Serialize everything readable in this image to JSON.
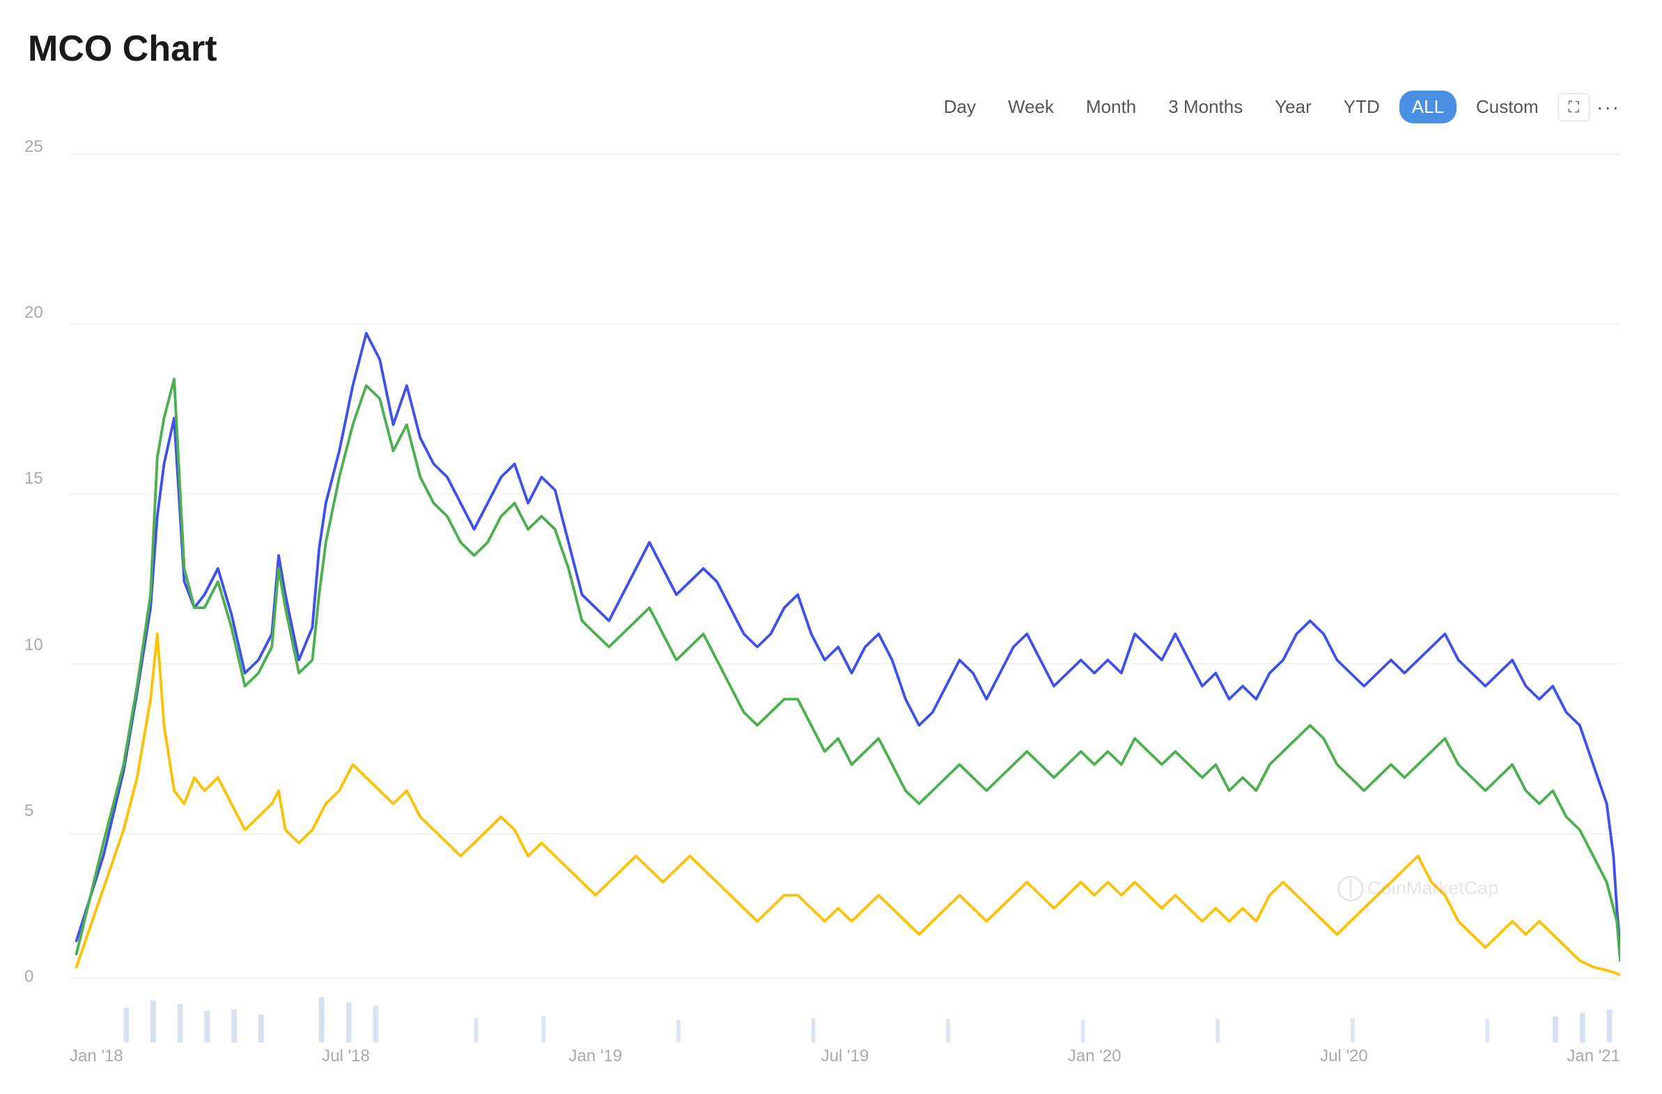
{
  "title": "MCO Chart",
  "toolbar": {
    "time_buttons": [
      {
        "label": "Day",
        "active": false
      },
      {
        "label": "Week",
        "active": false
      },
      {
        "label": "Month",
        "active": false
      },
      {
        "label": "3 Months",
        "active": false
      },
      {
        "label": "Year",
        "active": false
      },
      {
        "label": "YTD",
        "active": false
      },
      {
        "label": "ALL",
        "active": true
      },
      {
        "label": "Custom",
        "active": false
      }
    ],
    "fullscreen_icon": "⛶",
    "more_icon": "···"
  },
  "y_axis": {
    "labels": [
      "25",
      "20",
      "15",
      "10",
      "5",
      "0"
    ]
  },
  "x_axis": {
    "labels": [
      "Jan '18",
      "Jul '18",
      "Jan '19",
      "Jul '19",
      "Jan '20",
      "Jul '20",
      "Jan '21"
    ]
  },
  "watermark": "CoinMarketCap",
  "colors": {
    "blue": "#3f51e8",
    "green": "#4caf50",
    "orange": "#ffc107",
    "grid": "#f0f0f0",
    "volume": "#d0d8e8"
  }
}
